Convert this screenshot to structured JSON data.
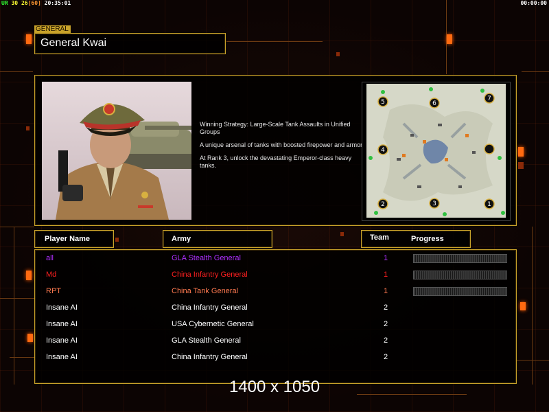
{
  "hud": {
    "left_prefix": "UR",
    "fps": "30",
    "fps2": "26",
    "fps_limit": "[60]",
    "clock": "20:35:01",
    "timer": "00:00:00"
  },
  "general": {
    "tag": "GENERAL",
    "name": "General Kwai"
  },
  "strategy": {
    "lines": [
      "Winning Strategy: Large-Scale Tank Assaults in Unified Groups",
      "A unique arsenal of tanks with boosted firepower and armor.",
      "At Rank 3, unlock the devastating Emperor-class heavy tanks."
    ]
  },
  "minimap": {
    "start_positions": [
      "5",
      "6",
      "7",
      "4",
      "",
      "2",
      "3",
      "1"
    ]
  },
  "table": {
    "headers": {
      "player": "Player Name",
      "army": "Army",
      "team": "Team",
      "progress": "Progress"
    },
    "rows": [
      {
        "name": "all",
        "army": "GLA Stealth General",
        "team": "1",
        "color": "#b030ff",
        "progress": true
      },
      {
        "name": "Md",
        "army": "China Infantry General",
        "team": "1",
        "color": "#ff2020",
        "progress": true
      },
      {
        "name": "RPT",
        "army": "China Tank General",
        "team": "1",
        "color": "#ff7a50",
        "progress": true
      },
      {
        "name": "Insane AI",
        "army": "China Infantry General",
        "team": "2",
        "color": "#ffffff",
        "progress": false
      },
      {
        "name": "Insane AI",
        "army": "USA Cybernetic General",
        "team": "2",
        "color": "#ffffff",
        "progress": false
      },
      {
        "name": "Insane AI",
        "army": "GLA Stealth General",
        "team": "2",
        "color": "#ffffff",
        "progress": false
      },
      {
        "name": "Insane AI",
        "army": "China Infantry General",
        "team": "2",
        "color": "#ffffff",
        "progress": false
      }
    ]
  },
  "resolution_label": "1400 x 1050",
  "colors": {
    "frame": "#c8a22a",
    "accent_glow": "#ff6a10"
  }
}
